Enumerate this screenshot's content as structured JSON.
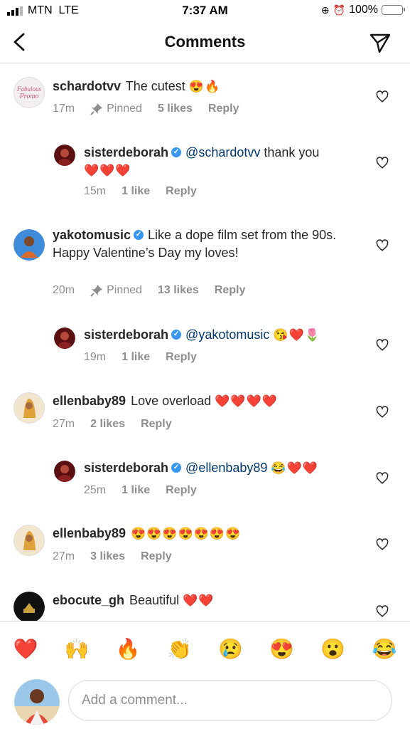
{
  "status_bar": {
    "carrier": "MTN",
    "network": "LTE",
    "time": "7:37 AM",
    "battery": "100%",
    "battery_color": "#f7c611"
  },
  "header": {
    "title": "Comments"
  },
  "comments": [
    {
      "username": "schardotvv",
      "verified": false,
      "mention": "",
      "text": "The cutest",
      "emojis": "😍🔥",
      "time": "17m",
      "pinned": "Pinned",
      "likes": "5 likes",
      "reply": "Reply",
      "reply_level": false
    },
    {
      "username": "sisterdeborah",
      "verified": true,
      "mention": "@schardotvv",
      "text": "thank you",
      "emojis": "❤️❤️❤️",
      "time": "15m",
      "pinned": "",
      "likes": "1 like",
      "reply": "Reply",
      "reply_level": true
    },
    {
      "username": "yakotomusic",
      "verified": true,
      "mention": "",
      "text": "Like a dope film set from the 90s.",
      "text2": "Happy Valentine’s Day my loves!",
      "emojis": "",
      "time": "20m",
      "pinned": "Pinned",
      "likes": "13 likes",
      "reply": "Reply",
      "reply_level": false
    },
    {
      "username": "sisterdeborah",
      "verified": true,
      "mention": "@yakotomusic",
      "text": "",
      "emojis": "😘❤️🌷",
      "time": "19m",
      "pinned": "",
      "likes": "1 like",
      "reply": "Reply",
      "reply_level": true
    },
    {
      "username": "ellenbaby89",
      "verified": false,
      "mention": "",
      "text": "Love overload",
      "emojis": "❤️❤️❤️❤️",
      "time": "27m",
      "pinned": "",
      "likes": "2 likes",
      "reply": "Reply",
      "reply_level": false
    },
    {
      "username": "sisterdeborah",
      "verified": true,
      "mention": "@ellenbaby89",
      "text": "",
      "emojis": "😂❤️❤️",
      "time": "25m",
      "pinned": "",
      "likes": "1 like",
      "reply": "Reply",
      "reply_level": true
    },
    {
      "username": "ellenbaby89",
      "verified": false,
      "mention": "",
      "text": "",
      "emojis": "😍😍😍😍😍😍😍",
      "time": "27m",
      "pinned": "",
      "likes": "3 likes",
      "reply": "Reply",
      "reply_level": false
    },
    {
      "username": "ebocute_gh",
      "verified": false,
      "mention": "",
      "text": "Beautiful",
      "emojis": "❤️❤️",
      "time": "",
      "pinned": "",
      "likes": "",
      "reply": "",
      "reply_level": false
    }
  ],
  "avatar_labels": {
    "schardotvv": "Fabulous Promo"
  },
  "emoji_bar": [
    "❤️",
    "🙌",
    "🔥",
    "👏",
    "😢",
    "😍",
    "😮",
    "😂"
  ],
  "input": {
    "placeholder": "Add a comment..."
  },
  "colors": {
    "mention": "#00376b",
    "verified": "#3897f0",
    "secondary_text": "#8e8e8e"
  }
}
